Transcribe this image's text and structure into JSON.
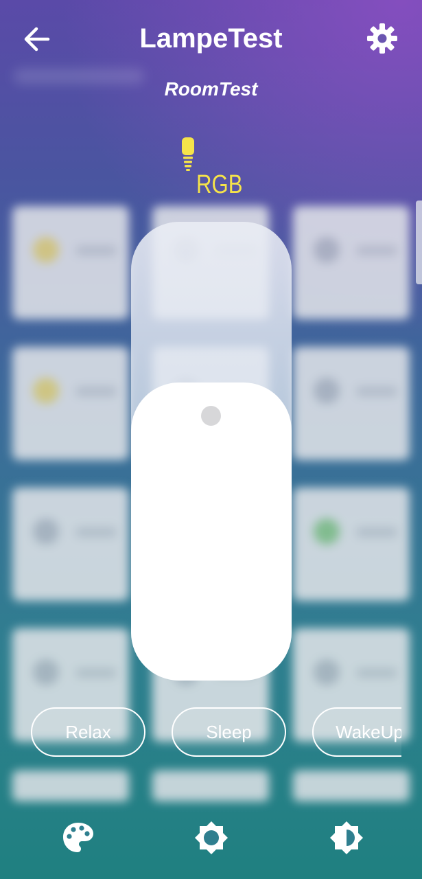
{
  "header": {
    "title": "LampeTest",
    "subtitle": "RoomTest"
  },
  "device": {
    "type_label": "RGB",
    "icon": "bulb-icon",
    "accent_color": "#f5e34a"
  },
  "brightness": {
    "level": 0.65
  },
  "scenes": [
    {
      "label": "Relax"
    },
    {
      "label": "Sleep"
    },
    {
      "label": "WakeUp"
    }
  ],
  "bottom_nav": [
    {
      "icon": "palette-icon"
    },
    {
      "icon": "brightness-icon"
    },
    {
      "icon": "contrast-icon"
    }
  ],
  "colors": {
    "gradient_top": "#5a4aa8",
    "gradient_bottom": "#1f8080",
    "slider_fill": "#ffffff"
  }
}
